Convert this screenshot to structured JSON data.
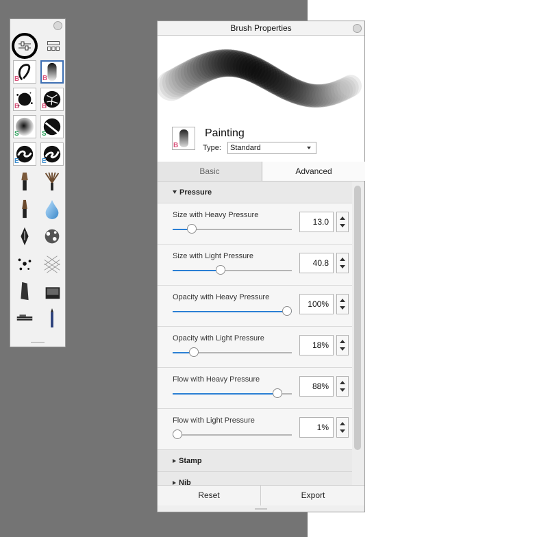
{
  "library": {
    "tools": [
      {
        "name": "brush-properties-toggle",
        "icon": "sliders-icon"
      },
      {
        "name": "brush-list-view",
        "icon": "list-grid-icon"
      }
    ],
    "brushes": [
      {
        "icon": "curve-stroke-icon",
        "badge": "B",
        "badge_color": "#d9527a"
      },
      {
        "icon": "soft-airbrush-icon",
        "badge": "B",
        "badge_color": "#d9527a",
        "selected": true
      },
      {
        "icon": "splatter-icon",
        "badge": "B",
        "badge_color": "#d9527a"
      },
      {
        "icon": "crackle-icon",
        "badge": "B",
        "badge_color": "#d9527a"
      },
      {
        "icon": "soft-sphere-icon",
        "badge": "S",
        "badge_color": "#2aa15a"
      },
      {
        "icon": "hard-sphere-icon",
        "badge": "S",
        "badge_color": "#2aa15a"
      },
      {
        "icon": "eraser-swirl-icon",
        "badge": "E",
        "badge_color": "#3c8ccd"
      },
      {
        "icon": "eraser-swirl-2-icon",
        "badge": "E",
        "badge_color": "#3c8ccd"
      },
      {
        "icon": "flat-brush-icon"
      },
      {
        "icon": "fan-brush-icon"
      },
      {
        "icon": "round-brush-icon"
      },
      {
        "icon": "water-drop-icon"
      },
      {
        "icon": "ink-pen-icon"
      },
      {
        "icon": "texture-brush-icon"
      },
      {
        "icon": "dots-brush-icon"
      },
      {
        "icon": "crosshatch-icon"
      },
      {
        "icon": "charcoal-icon"
      },
      {
        "icon": "marker-icon"
      },
      {
        "icon": "airbrush-nozzle-icon"
      },
      {
        "icon": "pencil-icon"
      }
    ]
  },
  "properties": {
    "title": "Brush Properties",
    "brush_name": "Painting",
    "brush_badge": "B",
    "type_label": "Type:",
    "type_value": "Standard",
    "tabs": {
      "basic": "Basic",
      "advanced": "Advanced"
    },
    "sections": {
      "pressure": "Pressure",
      "stamp": "Stamp",
      "next": "Nib"
    },
    "rows": [
      {
        "label": "Size with Heavy Pressure",
        "value": "13.0",
        "level": 0.16
      },
      {
        "label": "Size with Light Pressure",
        "value": "40.8",
        "level": 0.4
      },
      {
        "label": "Opacity with Heavy Pressure",
        "value": "100%",
        "level": 1.0
      },
      {
        "label": "Opacity with Light Pressure",
        "value": "18%",
        "level": 0.18
      },
      {
        "label": "Flow with Heavy Pressure",
        "value": "88%",
        "level": 0.88
      },
      {
        "label": "Flow with Light Pressure",
        "value": "1%",
        "level": 0.01
      }
    ],
    "buttons": {
      "reset": "Reset",
      "export": "Export"
    },
    "accent": "#2a7fd4"
  }
}
